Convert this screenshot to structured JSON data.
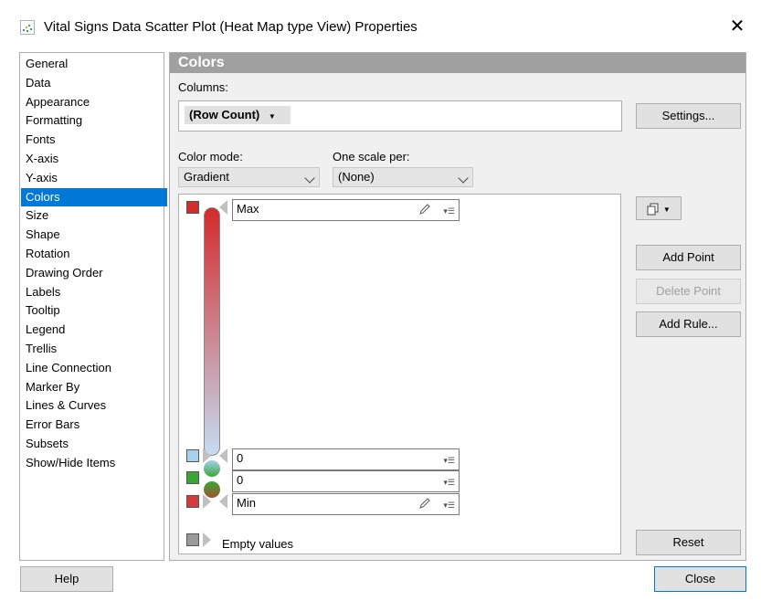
{
  "window": {
    "title": "Vital Signs Data Scatter Plot (Heat Map type View) Properties",
    "close_glyph": "✕",
    "icon": "scatter-plot-icon"
  },
  "sidebar": {
    "items": [
      {
        "label": "General"
      },
      {
        "label": "Data"
      },
      {
        "label": "Appearance"
      },
      {
        "label": "Formatting"
      },
      {
        "label": "Fonts"
      },
      {
        "label": "X-axis"
      },
      {
        "label": "Y-axis"
      },
      {
        "label": "Colors",
        "selected": true
      },
      {
        "label": "Size"
      },
      {
        "label": "Shape"
      },
      {
        "label": "Rotation"
      },
      {
        "label": "Drawing Order"
      },
      {
        "label": "Labels"
      },
      {
        "label": "Tooltip"
      },
      {
        "label": "Legend"
      },
      {
        "label": "Trellis"
      },
      {
        "label": "Line Connection"
      },
      {
        "label": "Marker By"
      },
      {
        "label": "Lines & Curves"
      },
      {
        "label": "Error Bars"
      },
      {
        "label": "Subsets"
      },
      {
        "label": "Show/Hide Items"
      }
    ]
  },
  "panel": {
    "header": "Colors",
    "columns_label": "Columns:",
    "column_value": "(Row Count)",
    "settings_button": "Settings...",
    "color_mode_label": "Color mode:",
    "color_mode_value": "Gradient",
    "scale_label": "One scale per:",
    "scale_value": "(None)"
  },
  "gradient": {
    "points": [
      {
        "label": "Max",
        "color": "#d42a2a"
      },
      {
        "label": "0",
        "color": "#a6d2ee"
      },
      {
        "label": "0",
        "color": "#3aa635"
      },
      {
        "label": "Min",
        "color": "#d43a3a"
      }
    ],
    "empty_label": "Empty values",
    "empty_color": "#9a9a9a",
    "top_color": "#d42a2a",
    "bottom_color": "#c5dcf2"
  },
  "buttons": {
    "add_point": "Add Point",
    "delete_point": "Delete Point",
    "add_rule": "Add Rule...",
    "reset": "Reset",
    "help": "Help",
    "close": "Close"
  },
  "colors": {
    "accent": "#0078d7",
    "header": "#a0a0a0"
  }
}
